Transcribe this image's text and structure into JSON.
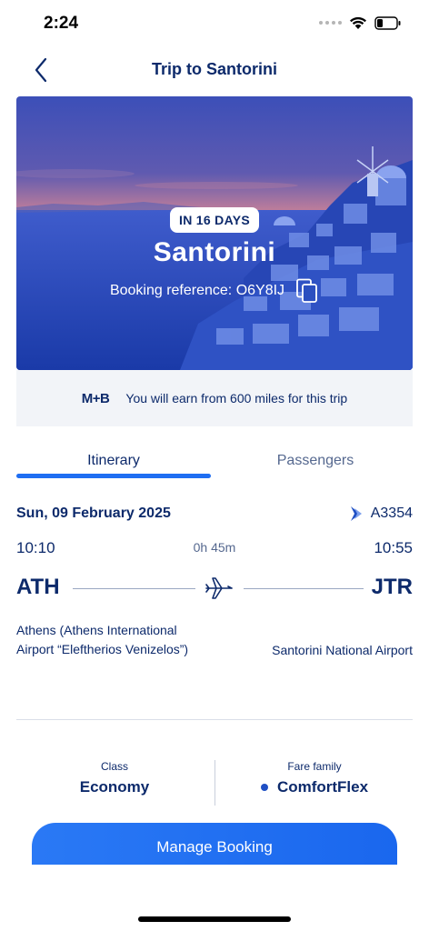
{
  "status_bar": {
    "time": "2:24"
  },
  "header": {
    "title": "Trip to Santorini",
    "back_icon": "chevron-left-icon"
  },
  "hero": {
    "badge": "IN 16 DAYS",
    "city": "Santorini",
    "booking_reference_label": "Booking reference: O6Y8IJ",
    "copy_icon": "copy-icon"
  },
  "miles_banner": {
    "logo": "M+B",
    "text": "You will earn from 600 miles for this trip"
  },
  "tabs": [
    {
      "label": "Itinerary",
      "selected": true
    },
    {
      "label": "Passengers",
      "selected": false
    }
  ],
  "flight": {
    "date": "Sun, 09 February 2025",
    "flight_number": "A3354",
    "departure_time": "10:10",
    "duration": "0h 45m",
    "arrival_time": "10:55",
    "departure_code": "ATH",
    "arrival_code": "JTR",
    "departure_airport": "Athens (Athens International Airport “Eleftherios Venizelos”)",
    "arrival_airport": "Santorini National Airport"
  },
  "fare": {
    "class_label": "Class",
    "class_value": "Economy",
    "fare_family_label": "Fare family",
    "fare_family_value": "ComfortFlex"
  },
  "actions": {
    "manage_booking": "Manage Booking"
  },
  "colors": {
    "primary": "#1f6ef2",
    "text": "#0d2a6b",
    "muted": "#55688f",
    "banner_bg": "#f2f4f8"
  }
}
